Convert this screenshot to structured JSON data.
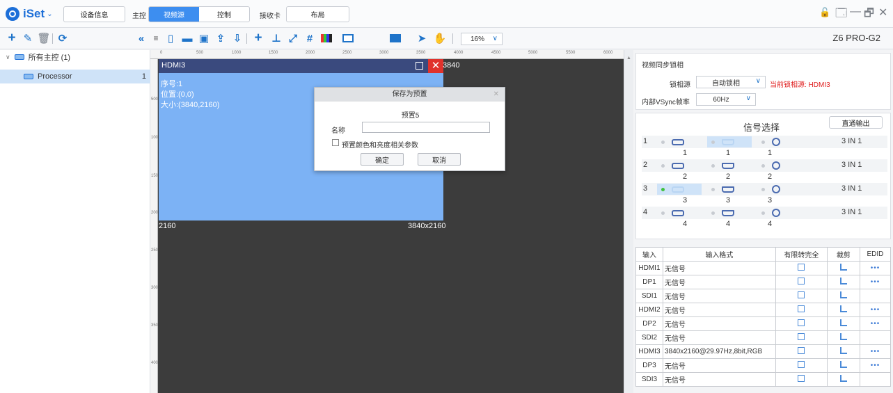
{
  "app": {
    "logo": "iSet",
    "logo_caret": "⌄",
    "device_info_btn": "设备信息",
    "master_label": "主控",
    "master_tabs": [
      "视频源",
      "控制"
    ],
    "receiver_label": "接收卡",
    "receiver_tabs": [
      "布局"
    ],
    "window_controls": {
      "lock": "🔓",
      "restore": "🗔",
      "minimize": "—",
      "maximize": "🗗",
      "close": "✕"
    }
  },
  "toolbar": {
    "zoom": "16%",
    "device_model": "Z6 PRO-G2"
  },
  "tree": {
    "root": "所有主控 (1)",
    "child": "Processor",
    "child_index": "1"
  },
  "rulers": {
    "top": [
      "0",
      "500",
      "1000",
      "1500",
      "2000",
      "2500",
      "3000",
      "3500",
      "4000",
      "4500",
      "5000",
      "5500",
      "6000"
    ],
    "left": [
      "500",
      "1000",
      "1500",
      "2000",
      "2500",
      "3000",
      "3500",
      "4000"
    ]
  },
  "layer": {
    "title": "HDMI3",
    "close_glyph": "✕",
    "seq": "序号:1",
    "pos": "位置:(0,0)",
    "size": "大小:(3840,2160)",
    "label_right_top": "3840",
    "label_left_bottom": "2160",
    "label_right_bottom": "3840x2160"
  },
  "dialog": {
    "title": "保存为预置",
    "close_glyph": "✕",
    "preset_name": "预置5",
    "name_label": "名称",
    "name_value": "",
    "checkbox_label": "预置颜色和亮度相关参数",
    "ok": "确定",
    "cancel": "取消"
  },
  "sync": {
    "title": "视频同步锁相",
    "source_label": "锁相源",
    "source_value": "自动锁相",
    "current": "当前锁相源: HDMI3",
    "vsync_label": "内部VSync帧率",
    "vsync_value": "60Hz"
  },
  "signal": {
    "title": "信号选择",
    "passthrough_btn": "直通输出",
    "rows": [
      {
        "num": "1",
        "mode": "3 IN 1"
      },
      {
        "num": "2",
        "mode": "3 IN 1"
      },
      {
        "num": "3",
        "mode": "3 IN 1"
      },
      {
        "num": "4",
        "mode": "3 IN 1"
      }
    ]
  },
  "inputs_table": {
    "headers": [
      "输入",
      "输入格式",
      "有限转完全",
      "裁剪",
      "EDID"
    ],
    "rows": [
      {
        "name": "HDMI1",
        "format": "无信号",
        "edid": "•••"
      },
      {
        "name": "DP1",
        "format": "无信号",
        "edid": "•••"
      },
      {
        "name": "SDI1",
        "format": "无信号",
        "edid": ""
      },
      {
        "name": "HDMI2",
        "format": "无信号",
        "edid": "•••"
      },
      {
        "name": "DP2",
        "format": "无信号",
        "edid": "•••"
      },
      {
        "name": "SDI2",
        "format": "无信号",
        "edid": ""
      },
      {
        "name": "HDMI3",
        "format": "3840x2160@29.97Hz,8bit,RGB",
        "edid": "•••"
      },
      {
        "name": "DP3",
        "format": "无信号",
        "edid": "•••"
      },
      {
        "name": "SDI3",
        "format": "无信号",
        "edid": ""
      }
    ]
  }
}
